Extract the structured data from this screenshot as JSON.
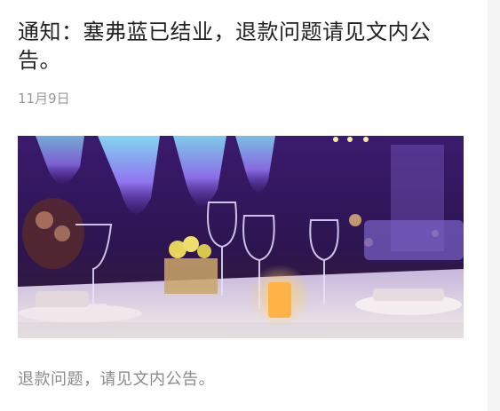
{
  "article": {
    "title": "通知：塞弗蓝已结业，退款问题请见文内公告。",
    "date": "11月9日",
    "excerpt": "退款问题，请见文内公告。"
  },
  "image": {
    "subject": "banquet-hall-table-photo"
  },
  "colors": {
    "title": "#222222",
    "meta": "#9a9a9a",
    "excerpt": "#8a8a8a",
    "card_bg": "#ffffff",
    "page_bg": "#f2f2f2"
  }
}
